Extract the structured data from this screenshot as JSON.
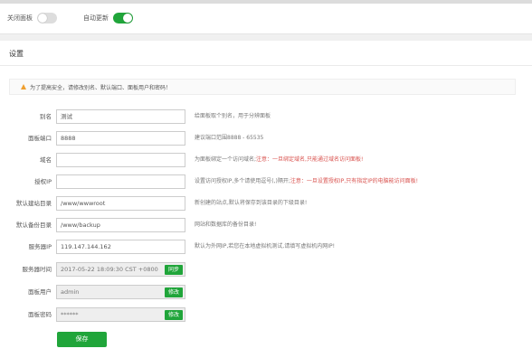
{
  "toggles": {
    "close_panel": {
      "label": "关闭面板",
      "state": "off"
    },
    "auto_update": {
      "label": "自动更新",
      "state": "on"
    }
  },
  "panel": {
    "title": "设置",
    "notice": "为了提高安全，请修改别名、默认端口、面板用户和密码！"
  },
  "fields": [
    {
      "label": "别名",
      "value": "测试",
      "help": "给面板取个别名，用于分辨面板",
      "help_red": ""
    },
    {
      "label": "面板端口",
      "value": "8888",
      "help": "建议端口范围8888 - 65535",
      "help_red": ""
    },
    {
      "label": "域名",
      "value": "",
      "help": "为面板绑定一个访问域名;",
      "help_red": "注意：一旦绑定域名,只能通过域名访问面板!"
    },
    {
      "label": "授权IP",
      "value": "",
      "help": "设置访问授权IP,多个请使用逗号(,)隔开;",
      "help_red": "注意：一旦设置授权IP,只有指定IP的电脑能访问面板!"
    },
    {
      "label": "默认建站目录",
      "value": "/www/wwwroot",
      "help": "新创建的站点,默认将保存到该目录的下级目录!",
      "help_red": ""
    },
    {
      "label": "默认备份目录",
      "value": "/www/backup",
      "help": "网站和数据库的备份目录!",
      "help_red": ""
    },
    {
      "label": "服务器IP",
      "value": "119.147.144.162",
      "help": "默认为外网IP,若您在本地虚拟机测试,请填写虚拟机内网IP!",
      "help_red": ""
    },
    {
      "label": "服务器时间",
      "value": "2017-05-22 18:09:30 CST +0800",
      "button": "同步"
    },
    {
      "label": "面板用户",
      "value": "admin",
      "button": "修改"
    },
    {
      "label": "面板密码",
      "value": "******",
      "button": "修改"
    }
  ],
  "save_label": "保存",
  "colors": {
    "accent": "#20a53a",
    "warning": "#f0a030",
    "danger": "#d9534f"
  }
}
